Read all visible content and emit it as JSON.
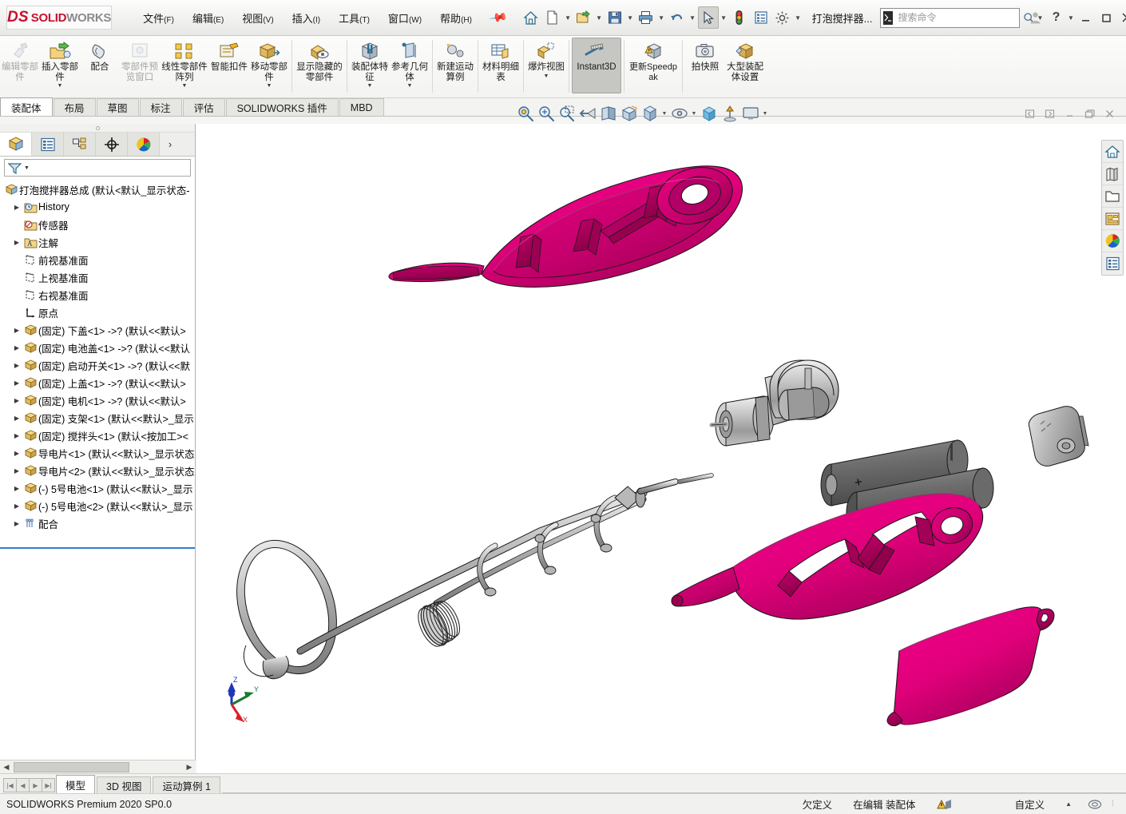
{
  "app": {
    "logo_ds": "DS",
    "logo_solid": "SOLID",
    "logo_works": "WORKS",
    "document_title": "打泡搅拌器...",
    "version_status": "SOLIDWORKS Premium 2020 SP0.0"
  },
  "menu": [
    {
      "label": "文件",
      "mnemonic": "(F)",
      "name": "menu-file"
    },
    {
      "label": "编辑",
      "mnemonic": "(E)",
      "name": "menu-edit"
    },
    {
      "label": "视图",
      "mnemonic": "(V)",
      "name": "menu-view"
    },
    {
      "label": "插入",
      "mnemonic": "(I)",
      "name": "menu-insert"
    },
    {
      "label": "工具",
      "mnemonic": "(T)",
      "name": "menu-tools"
    },
    {
      "label": "窗口",
      "mnemonic": "(W)",
      "name": "menu-window"
    },
    {
      "label": "帮助",
      "mnemonic": "(H)",
      "name": "menu-help"
    }
  ],
  "quick_access": [
    {
      "icon": "home-icon",
      "name": "home-button",
      "caret": false
    },
    {
      "icon": "new-document-icon",
      "name": "new-document-button",
      "caret": true
    },
    {
      "icon": "open-folder-icon",
      "name": "open-document-button",
      "caret": true
    },
    {
      "icon": "save-icon",
      "name": "save-button",
      "caret": true
    },
    {
      "icon": "print-icon",
      "name": "print-button",
      "caret": true
    },
    {
      "icon": "undo-icon",
      "name": "undo-button",
      "caret": true
    },
    {
      "icon": "select-cursor-icon",
      "name": "select-button",
      "caret": true,
      "selected": true
    },
    {
      "icon": "traffic-light-icon",
      "name": "rebuild-status-button",
      "caret": false
    },
    {
      "icon": "options-list-icon",
      "name": "display-list-button",
      "caret": false
    },
    {
      "icon": "gear-icon",
      "name": "options-button",
      "caret": true
    }
  ],
  "search": {
    "placeholder": "搜索命令",
    "value": "",
    "command_badge": "▶_",
    "name": "search-commands-input"
  },
  "window_buttons": [
    {
      "icon": "user-icon",
      "name": "user-account-button"
    },
    {
      "icon": "help-icon",
      "name": "help-button",
      "label": "?"
    },
    {
      "icon": "chevron-down-icon",
      "name": "help-dropdown-button"
    },
    {
      "icon": "minimize-icon",
      "name": "minimize-button"
    },
    {
      "icon": "maximize-icon",
      "name": "maximize-button"
    },
    {
      "icon": "close-icon",
      "name": "close-button"
    }
  ],
  "ribbon": {
    "groups": [
      {
        "buttons": [
          {
            "label": "编辑零部件",
            "icon": "edit-component-icon",
            "disabled": true,
            "dropdown": false,
            "name": "ribbon-edit-component"
          },
          {
            "label": "插入零部件",
            "icon": "insert-component-icon",
            "disabled": false,
            "dropdown": true,
            "name": "ribbon-insert-component"
          },
          {
            "label": "配合",
            "icon": "mate-icon",
            "disabled": false,
            "dropdown": false,
            "name": "ribbon-mate"
          },
          {
            "label": "零部件预览窗口",
            "icon": "component-preview-icon",
            "disabled": true,
            "dropdown": false,
            "name": "ribbon-component-preview"
          },
          {
            "label": "线性零部件阵列",
            "icon": "linear-component-pattern-icon",
            "disabled": false,
            "dropdown": true,
            "name": "ribbon-linear-pattern"
          },
          {
            "label": "智能扣件",
            "icon": "smart-fasteners-icon",
            "disabled": false,
            "dropdown": false,
            "name": "ribbon-smart-fasteners"
          },
          {
            "label": "移动零部件",
            "icon": "move-component-icon",
            "disabled": false,
            "dropdown": true,
            "name": "ribbon-move-component"
          }
        ]
      },
      {
        "buttons": [
          {
            "label": "显示隐藏的零部件",
            "icon": "show-hidden-components-icon",
            "disabled": false,
            "dropdown": false,
            "name": "ribbon-show-hidden-components"
          }
        ]
      },
      {
        "buttons": [
          {
            "label": "装配体特征",
            "icon": "assembly-features-icon",
            "disabled": false,
            "dropdown": true,
            "name": "ribbon-assembly-features"
          },
          {
            "label": "参考几何体",
            "icon": "reference-geometry-icon",
            "disabled": false,
            "dropdown": true,
            "name": "ribbon-reference-geometry"
          }
        ]
      },
      {
        "buttons": [
          {
            "label": "新建运动算例",
            "icon": "new-motion-study-icon",
            "disabled": false,
            "dropdown": false,
            "name": "ribbon-new-motion-study"
          }
        ]
      },
      {
        "buttons": [
          {
            "label": "材料明细表",
            "icon": "bill-of-materials-icon",
            "disabled": false,
            "dropdown": false,
            "name": "ribbon-bom"
          }
        ]
      },
      {
        "buttons": [
          {
            "label": "爆炸视图",
            "icon": "exploded-view-icon",
            "disabled": false,
            "dropdown": true,
            "name": "ribbon-exploded-view"
          }
        ]
      },
      {
        "buttons": [
          {
            "label": "Instant3D",
            "icon": "instant3d-icon",
            "disabled": false,
            "dropdown": false,
            "active": true,
            "latin": true,
            "name": "ribbon-instant3d"
          }
        ]
      },
      {
        "buttons": [
          {
            "label": "更新Speedpak",
            "icon": "update-speedpak-icon",
            "disabled": false,
            "dropdown": false,
            "name": "ribbon-update-speedpak"
          }
        ]
      },
      {
        "buttons": [
          {
            "label": "拍快照",
            "icon": "take-snapshot-icon",
            "disabled": false,
            "dropdown": false,
            "name": "ribbon-take-snapshot"
          },
          {
            "label": "大型装配体设置",
            "icon": "large-assembly-settings-icon",
            "disabled": false,
            "dropdown": false,
            "name": "ribbon-large-assembly-settings"
          }
        ]
      }
    ]
  },
  "command_tabs": [
    {
      "label": "装配体",
      "active": true,
      "name": "tab-assembly"
    },
    {
      "label": "布局",
      "active": false,
      "name": "tab-layout"
    },
    {
      "label": "草图",
      "active": false,
      "name": "tab-sketch"
    },
    {
      "label": "标注",
      "active": false,
      "name": "tab-markup"
    },
    {
      "label": "评估",
      "active": false,
      "name": "tab-evaluate"
    },
    {
      "label": "SOLIDWORKS 插件",
      "active": false,
      "name": "tab-solidworks-addins"
    },
    {
      "label": "MBD",
      "active": false,
      "name": "tab-mbd"
    }
  ],
  "view_toolbar": [
    {
      "icon": "zoom-to-fit-icon",
      "name": "view-zoom-to-fit",
      "caret": false
    },
    {
      "icon": "zoom-to-area-icon",
      "name": "view-zoom-to-area",
      "caret": false
    },
    {
      "icon": "magnifier-icon",
      "name": "view-zoom-window",
      "caret": false
    },
    {
      "icon": "previous-view-icon",
      "name": "view-previous",
      "caret": false
    },
    {
      "icon": "section-view-icon",
      "name": "view-section",
      "caret": false
    },
    {
      "icon": "view-orientation-icon",
      "name": "view-orientation",
      "caret": false
    },
    {
      "icon": "display-style-icon",
      "name": "view-display-style",
      "caret": true
    },
    {
      "icon": "hide-show-items-icon",
      "name": "view-hide-show-items",
      "caret": true
    },
    {
      "icon": "appearances-icon",
      "name": "view-appearances",
      "caret": true
    },
    {
      "icon": "scene-icon",
      "name": "view-scene",
      "caret": false
    },
    {
      "icon": "apply-scene-icon",
      "name": "view-apply-scene",
      "caret": false
    },
    {
      "icon": "view-settings-icon",
      "name": "view-settings",
      "caret": true
    }
  ],
  "doc_window_buttons": [
    {
      "icon": "restore-left-icon",
      "name": "doc-tile-left-button"
    },
    {
      "icon": "restore-right-icon",
      "name": "doc-tile-right-button"
    },
    {
      "icon": "minimize-icon",
      "name": "doc-minimize-button"
    },
    {
      "icon": "restore-icon",
      "name": "doc-restore-button"
    },
    {
      "icon": "close-icon",
      "name": "doc-close-button"
    }
  ],
  "left_panel": {
    "tabs": [
      {
        "icon": "feature-manager-icon",
        "active": true,
        "name": "panel-tab-feature-manager"
      },
      {
        "icon": "property-manager-icon",
        "active": false,
        "name": "panel-tab-property-manager"
      },
      {
        "icon": "configuration-manager-icon",
        "active": false,
        "name": "panel-tab-configuration-manager"
      },
      {
        "icon": "dimxpert-manager-icon",
        "active": false,
        "name": "panel-tab-dimxpert-manager"
      },
      {
        "icon": "display-manager-icon",
        "active": false,
        "name": "panel-tab-display-manager"
      }
    ],
    "filter_placeholder": "",
    "tree": [
      {
        "label": "打泡搅拌器总成  (默认<默认_显示状态-",
        "icon": "assembly-icon",
        "indent": 0,
        "expandable": false,
        "root": true,
        "name": "tree-root-assembly"
      },
      {
        "label": "History",
        "icon": "history-icon",
        "indent": 1,
        "expandable": true,
        "name": "tree-item-history"
      },
      {
        "label": "传感器",
        "icon": "sensors-icon",
        "indent": 1,
        "expandable": false,
        "name": "tree-item-sensors"
      },
      {
        "label": "注解",
        "icon": "annotations-icon",
        "indent": 1,
        "expandable": true,
        "name": "tree-item-annotations"
      },
      {
        "label": "前视基准面",
        "icon": "plane-icon",
        "indent": 1,
        "expandable": false,
        "name": "tree-item-front-plane"
      },
      {
        "label": "上视基准面",
        "icon": "plane-icon",
        "indent": 1,
        "expandable": false,
        "name": "tree-item-top-plane"
      },
      {
        "label": "右视基准面",
        "icon": "plane-icon",
        "indent": 1,
        "expandable": false,
        "name": "tree-item-right-plane"
      },
      {
        "label": "原点",
        "icon": "origin-icon",
        "indent": 1,
        "expandable": false,
        "name": "tree-item-origin"
      },
      {
        "label": "(固定) 下盖<1>  ->? (默认<<默认>",
        "icon": "component-icon",
        "indent": 1,
        "expandable": true,
        "name": "tree-item-lower-cover"
      },
      {
        "label": "(固定) 电池盖<1>  ->? (默认<<默认",
        "icon": "component-icon",
        "indent": 1,
        "expandable": true,
        "name": "tree-item-battery-cover"
      },
      {
        "label": "(固定) 启动开关<1>  ->? (默认<<默",
        "icon": "component-icon",
        "indent": 1,
        "expandable": true,
        "name": "tree-item-start-switch"
      },
      {
        "label": "(固定) 上盖<1>  ->? (默认<<默认>",
        "icon": "component-icon",
        "indent": 1,
        "expandable": true,
        "name": "tree-item-upper-cover"
      },
      {
        "label": "(固定) 电机<1>  ->? (默认<<默认>",
        "icon": "component-icon",
        "indent": 1,
        "expandable": true,
        "name": "tree-item-motor"
      },
      {
        "label": "(固定) 支架<1>  (默认<<默认>_显示",
        "icon": "component-icon",
        "indent": 1,
        "expandable": true,
        "name": "tree-item-bracket"
      },
      {
        "label": "(固定) 搅拌头<1>  (默认<按加工><",
        "icon": "component-icon",
        "indent": 1,
        "expandable": true,
        "name": "tree-item-mixing-head"
      },
      {
        "label": "导电片<1>  (默认<<默认>_显示状态",
        "icon": "component-icon",
        "indent": 1,
        "expandable": true,
        "name": "tree-item-conductive-plate-1"
      },
      {
        "label": "导电片<2>  (默认<<默认>_显示状态",
        "icon": "component-icon",
        "indent": 1,
        "expandable": true,
        "name": "tree-item-conductive-plate-2"
      },
      {
        "label": "(-) 5号电池<1>  (默认<<默认>_显示",
        "icon": "component-icon",
        "indent": 1,
        "expandable": true,
        "name": "tree-item-aa-battery-1"
      },
      {
        "label": "(-) 5号电池<2>  (默认<<默认>_显示",
        "icon": "component-icon",
        "indent": 1,
        "expandable": true,
        "name": "tree-item-aa-battery-2"
      },
      {
        "label": "配合",
        "icon": "mates-folder-icon",
        "indent": 1,
        "expandable": true,
        "name": "tree-item-mates"
      }
    ]
  },
  "right_toolbar": [
    {
      "icon": "home-icon",
      "name": "task-pane-sw-resources"
    },
    {
      "icon": "design-library-icon",
      "name": "task-pane-design-library"
    },
    {
      "icon": "file-explorer-icon",
      "name": "task-pane-file-explorer"
    },
    {
      "icon": "view-palette-icon",
      "name": "task-pane-view-palette"
    },
    {
      "icon": "appearances-scenes-icon",
      "name": "task-pane-appearances-scenes"
    },
    {
      "icon": "custom-properties-icon",
      "name": "task-pane-custom-properties"
    }
  ],
  "bottom_tabs": [
    {
      "label": "模型",
      "active": true,
      "name": "bottom-tab-model"
    },
    {
      "label": "3D 视图",
      "active": false,
      "name": "bottom-tab-3d-views"
    },
    {
      "label": "运动算例 1",
      "active": false,
      "name": "bottom-tab-motion-study-1"
    }
  ],
  "status_bar": {
    "version": "SOLIDWORKS Premium 2020 SP0.0",
    "underdefined": "欠定义",
    "editing": "在编辑 装配体",
    "customize": "自定义"
  },
  "triad": {
    "x_label": "X",
    "y_label": "Y",
    "z_label": "Z",
    "x_color": "#d91f26",
    "y_color": "#1a7a2e",
    "z_color": "#1c38b8"
  },
  "model_colors": {
    "pink": "#e6007e",
    "pink_dark": "#b00063",
    "pink_mid": "#cf0070",
    "metal_light": "#d8d8d8",
    "metal_mid": "#a8a8a8",
    "metal_dark": "#6e6e6e",
    "outline": "#1a1a1a"
  }
}
